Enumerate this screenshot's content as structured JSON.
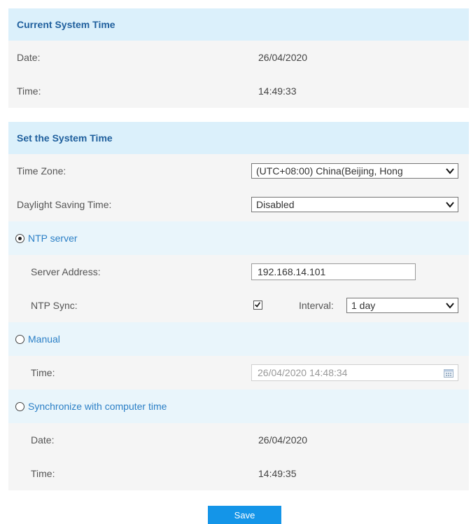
{
  "current": {
    "title": "Current System Time",
    "date_label": "Date:",
    "date_value": "26/04/2020",
    "time_label": "Time:",
    "time_value": "14:49:33"
  },
  "set": {
    "title": "Set the System Time",
    "timezone_label": "Time Zone:",
    "timezone_value": "(UTC+08:00) China(Beijing, Hong",
    "dst_label": "Daylight Saving Time:",
    "dst_value": "Disabled",
    "ntp_option": "NTP server",
    "ntp_selected": true,
    "server_address_label": "Server Address:",
    "server_address_value": "192.168.14.101",
    "ntp_sync_label": "NTP Sync:",
    "ntp_sync_checked": true,
    "interval_label": "Interval:",
    "interval_value": "1 day",
    "manual_option": "Manual",
    "manual_time_label": "Time:",
    "manual_time_value": "26/04/2020 14:48:34",
    "sync_option": "Synchronize with computer time",
    "sync_date_label": "Date:",
    "sync_date_value": "26/04/2020",
    "sync_time_label": "Time:",
    "sync_time_value": "14:49:35"
  },
  "save_label": "Save",
  "icons": {
    "dropdown": "chevron-down-icon",
    "checkbox": "checkmark-icon",
    "calendar": "calendar-icon"
  },
  "colors": {
    "header_bg": "#dbf0fb",
    "header_text": "#1f5f9d",
    "accent": "#1495e8",
    "radio_text": "#2b7fc6"
  }
}
